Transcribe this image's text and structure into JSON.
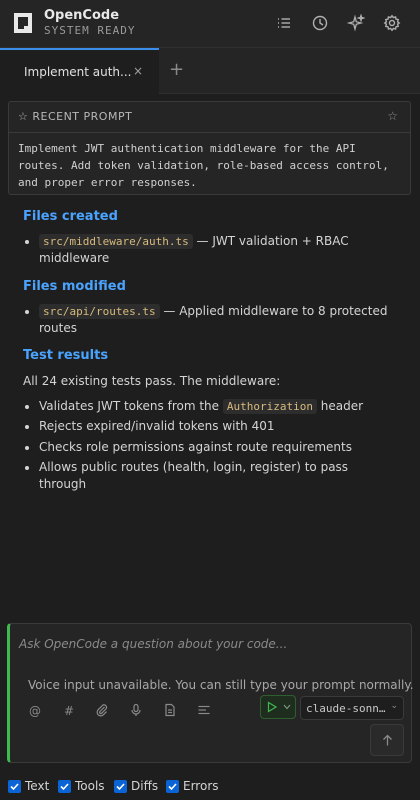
{
  "header": {
    "app_name": "OpenCode",
    "status": "SYSTEM READY",
    "icons": [
      "list-icon",
      "clock-icon",
      "sparkles-icon",
      "gear-icon"
    ]
  },
  "tabs": {
    "active_label": "Implement auth...",
    "close_glyph": "×",
    "add_glyph": "+"
  },
  "recent_prompt": {
    "title": "☆ RECENT PROMPT",
    "star_glyph": "☆",
    "lines": [
      "Implement JWT authentication middleware for the API",
      "routes. Add token validation, role-based access control,",
      "and proper error responses."
    ]
  },
  "response": {
    "files_created": {
      "title": "Files created",
      "item_code": "src/middleware/auth.ts",
      "item_text_1": " — JWT validation + RBAC",
      "item_text_2": "middleware"
    },
    "files_modified": {
      "title": "Files modified",
      "item_code": "src/api/routes.ts",
      "item_text_1": " — Applied middleware to 8 protected",
      "item_text_2": "routes"
    },
    "test_results": {
      "title": "Test results",
      "summary": "All 24 existing tests pass. The middleware:",
      "bullet_1_pre": "Validates JWT tokens from the ",
      "bullet_1_code": "Authorization",
      "bullet_1_post": " header",
      "bullet_2": "Rejects expired/invalid tokens with 401",
      "bullet_3": "Checks role permissions against route requirements",
      "bullet_4": "Allows public routes (health, login, register) to pass through"
    }
  },
  "composer": {
    "placeholder": "Ask OpenCode a question about your code...",
    "voice_message": "Voice input unavailable. You can still type your prompt normally.",
    "tool_icons": [
      "at-icon",
      "hash-icon",
      "paperclip-icon",
      "microphone-icon",
      "file-icon",
      "list-icon"
    ],
    "at_glyph": "@",
    "hash_glyph": "#",
    "model_label": "claude-sonn…",
    "chevron_glyph": "⌄"
  },
  "filters": [
    {
      "label": "Text",
      "checked": true
    },
    {
      "label": "Tools",
      "checked": true
    },
    {
      "label": "Diffs",
      "checked": true
    },
    {
      "label": "Errors",
      "checked": true
    }
  ],
  "colors": {
    "accent_blue": "#4aa3ff",
    "accent_green": "#3fb950",
    "checkbox_blue": "#0a64d6",
    "code_text": "#d7ba7d"
  }
}
